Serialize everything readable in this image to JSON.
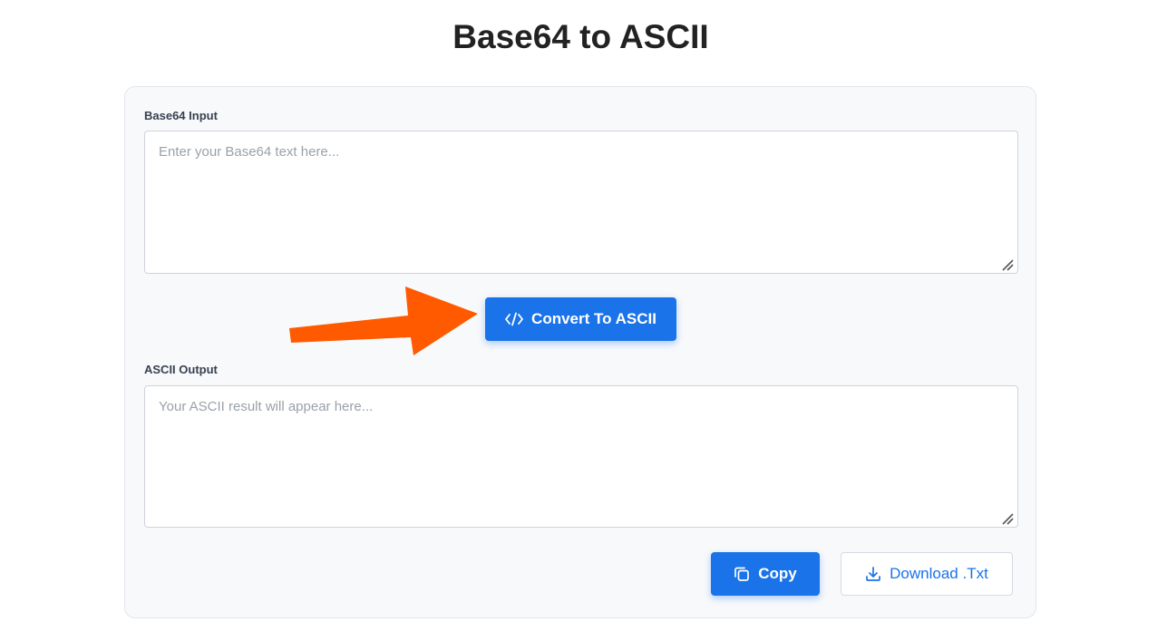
{
  "page": {
    "title": "Base64 to ASCII"
  },
  "input": {
    "label": "Base64 Input",
    "placeholder": "Enter your Base64 text here...",
    "value": ""
  },
  "convert_button": {
    "label": "Convert To ASCII",
    "icon": "code-icon"
  },
  "output": {
    "label": "ASCII Output",
    "placeholder": "Your ASCII result will appear here...",
    "value": ""
  },
  "actions": {
    "copy_label": "Copy",
    "copy_icon": "copy-icon",
    "download_label": "Download .Txt",
    "download_icon": "download-icon"
  },
  "colors": {
    "primary": "#1a73e8",
    "arrow": "#ff5a00",
    "card_background": "#f8f9fb"
  }
}
